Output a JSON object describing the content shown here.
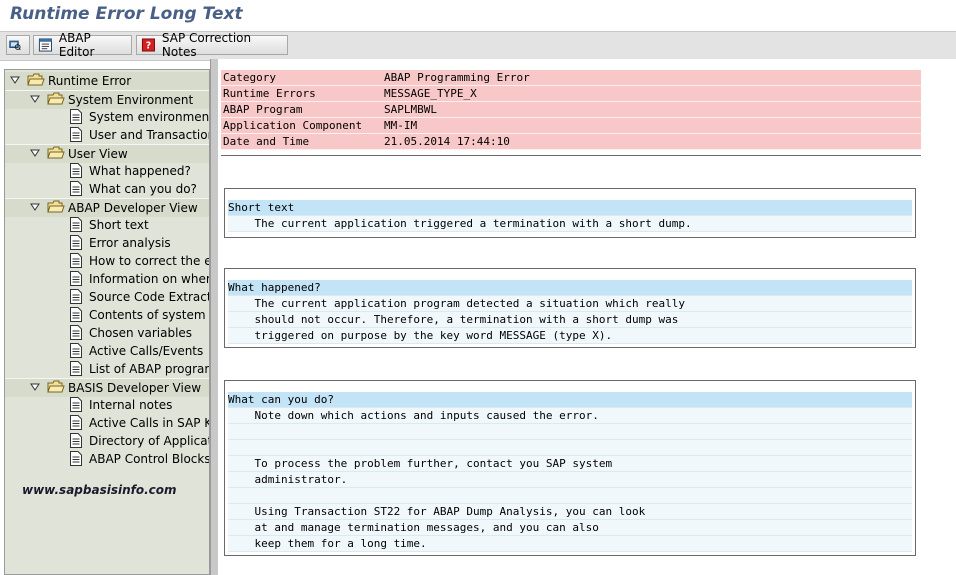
{
  "window": {
    "title": "Runtime Error Long Text"
  },
  "toolbar": {
    "icon_button": "display-icon",
    "abap_editor_label": "ABAP Editor",
    "sap_notes_label": "SAP Correction Notes"
  },
  "tree": {
    "root": "Runtime Error",
    "groups": [
      {
        "label": "System Environment",
        "items": [
          "System environment",
          "User and Transaction"
        ]
      },
      {
        "label": "User View",
        "items": [
          "What happened?",
          "What can you do?"
        ]
      },
      {
        "label": "ABAP Developer View",
        "items": [
          "Short text",
          "Error analysis",
          "How to correct the er",
          "Information on where",
          "Source Code Extract",
          "Contents of system fie",
          "Chosen variables",
          "Active Calls/Events",
          "List of ABAP programs"
        ]
      },
      {
        "label": "BASIS Developer View",
        "items": [
          "Internal notes",
          "Active Calls in SAP Ker",
          "Directory of Applicatio",
          "ABAP Control Blocks (("
        ]
      }
    ]
  },
  "header": {
    "rows": [
      {
        "key": "Category",
        "value": "ABAP Programming Error"
      },
      {
        "key": "Runtime Errors",
        "value": "MESSAGE_TYPE_X"
      },
      {
        "key": "ABAP Program",
        "value": "SAPLMBWL"
      },
      {
        "key": "Application Component",
        "value": "MM-IM"
      },
      {
        "key": "Date and Time",
        "value": "21.05.2014 17:44:10"
      }
    ]
  },
  "sections": [
    {
      "title": "Short text",
      "lines": [
        "    The current application triggered a termination with a short dump."
      ]
    },
    {
      "title": "What happened?",
      "lines": [
        "    The current application program detected a situation which really",
        "    should not occur. Therefore, a termination with a short dump was",
        "    triggered on purpose by the key word MESSAGE (type X)."
      ]
    },
    {
      "title": "What can you do?",
      "lines": [
        "    Note down which actions and inputs caused the error.",
        "",
        "",
        "    To process the problem further, contact you SAP system",
        "    administrator.",
        "",
        "    Using Transaction ST22 for ABAP Dump Analysis, you can look",
        "    at and manage termination messages, and you can also",
        "    keep them for a long time."
      ]
    }
  ],
  "watermark": "www.sapbasisinfo.com",
  "colors": {
    "title": "#4a5f86",
    "header_bg": "#f8c8c8",
    "section_head_bg": "#c3e4f6",
    "section_line_bg": "#f1f8fc",
    "tree_bg": "#e0e4d8"
  }
}
